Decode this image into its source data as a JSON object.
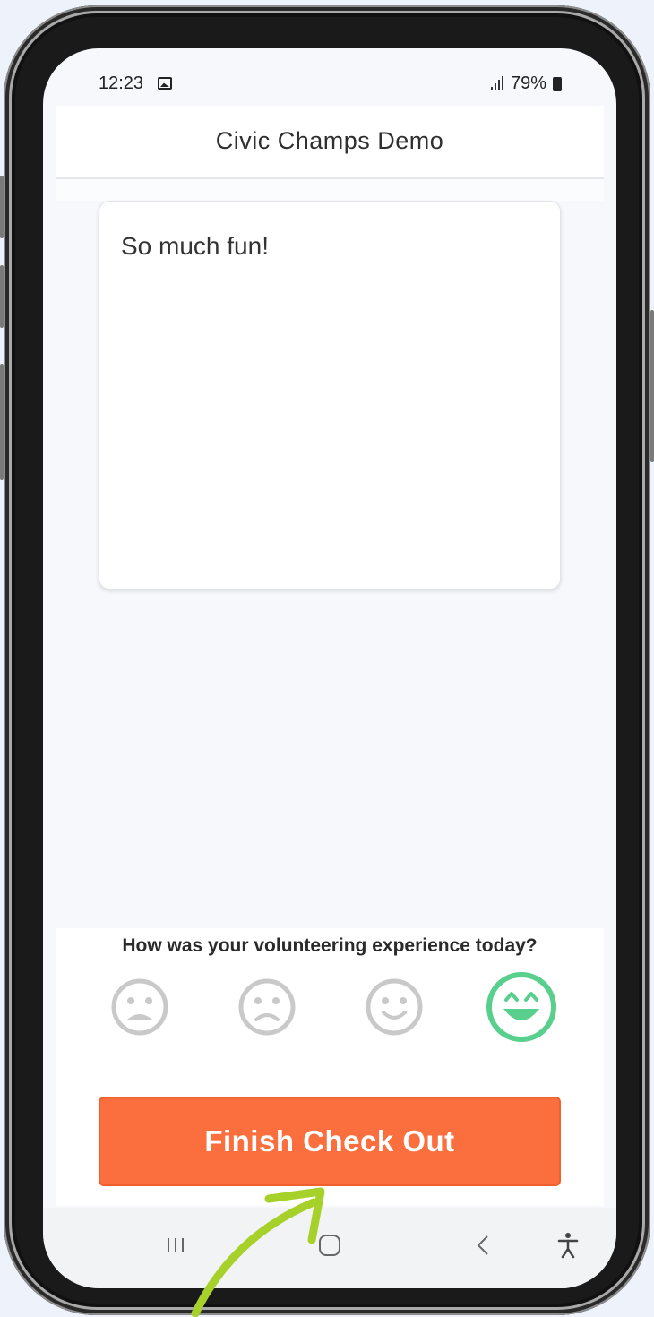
{
  "status_bar": {
    "time": "12:23",
    "battery": "79%"
  },
  "header": {
    "title": "Civic Champs Demo"
  },
  "feedback": {
    "text": "So much fun!"
  },
  "rating": {
    "question": "How was your volunteering experience today?",
    "options": [
      "very-unhappy",
      "unhappy",
      "happy",
      "very-happy"
    ],
    "selected": "very-happy",
    "inactive_color": "#c9c9c9",
    "selected_color": "#58cf8c"
  },
  "actions": {
    "finish_label": "Finish Check Out",
    "finish_color": "#fb6e3d"
  },
  "navigation": {
    "buttons": [
      "recent-apps",
      "home",
      "back",
      "accessibility"
    ]
  },
  "annotation": {
    "arrow_color": "#a6d12a"
  }
}
